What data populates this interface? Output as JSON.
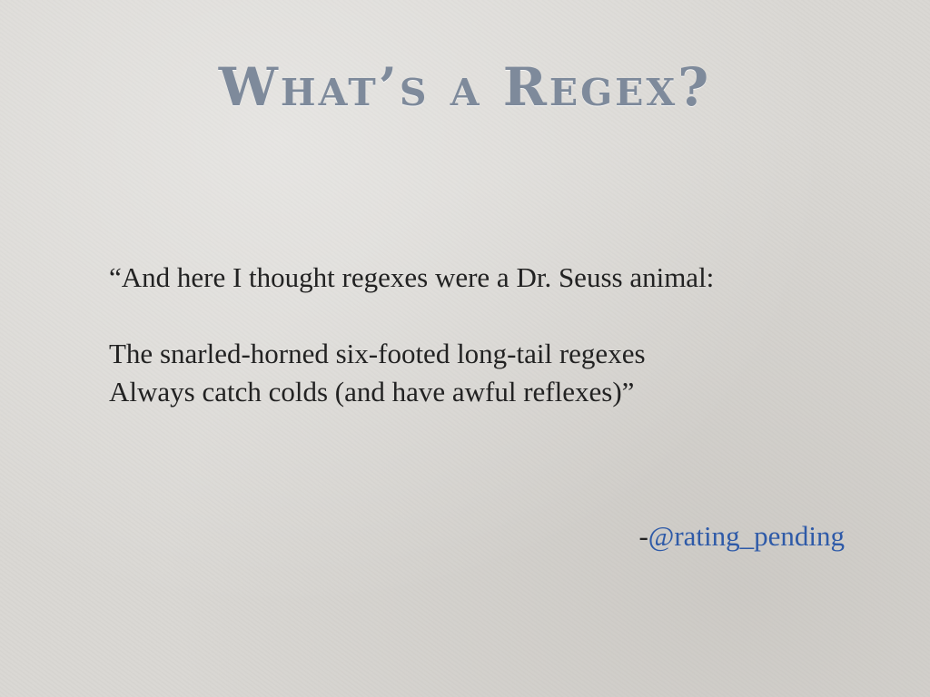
{
  "slide": {
    "title": "What’s a Regex?",
    "quote": {
      "line1": "“And here I thought regexes were a Dr. Seuss animal:",
      "line2": "The snarled-horned six-footed long-tail regexes",
      "line3": "Always catch colds (and have awful reflexes)”"
    },
    "attribution": {
      "prefix": "-",
      "handle": "@rating_pending"
    },
    "colors": {
      "title": "#7e8a9b",
      "body_text": "#222222",
      "link": "#2e5aa8",
      "background": "#d9d7d3"
    }
  }
}
